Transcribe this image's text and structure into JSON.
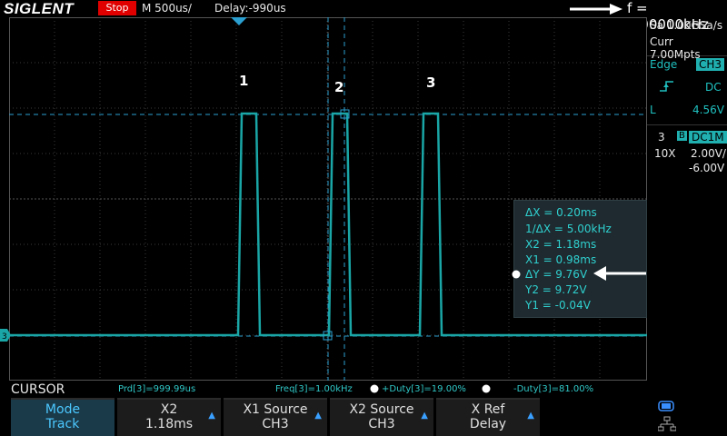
{
  "header": {
    "brand": "SIGLENT",
    "run_state": "Stop",
    "timebase": "M 500us/",
    "delay": "Delay:-990us",
    "frequency": "f = 1.00000kHz"
  },
  "acquisition": {
    "sample_rate": "Sa 1.00GSa/s",
    "memory": "Curr 7.00Mpts"
  },
  "trigger": {
    "type": "Edge",
    "source": "CH3",
    "coupling": "DC",
    "level_label": "L",
    "level": "4.56V"
  },
  "channel": {
    "number": "3",
    "bw_icon": "B",
    "coupling": "DC1M",
    "probe": "10X",
    "scale": "2.00V/",
    "offset": "-6.00V"
  },
  "markers": [
    "1",
    "2",
    "3"
  ],
  "cursor_readout": {
    "dx": "ΔX = 0.20ms",
    "inv_dx": "1/ΔX = 5.00kHz",
    "x2": "X2 = 1.18ms",
    "x1": "X1 = 0.98ms",
    "dy": "ΔY = 9.76V",
    "y2": "Y2 = 9.72V",
    "y1": "Y1 = -0.04V"
  },
  "measurements": {
    "title": "CURSOR",
    "prd": "Prd[3]=999.99us",
    "freq": "Freq[3]=1.00kHz",
    "pos_duty": "+Duty[3]=19.00%",
    "neg_duty": "-Duty[3]=81.00%"
  },
  "softkeys": [
    {
      "line1": "Mode",
      "line2": "Track"
    },
    {
      "line1": "X2",
      "line2": "1.18ms"
    },
    {
      "line1": "X1 Source",
      "line2": "CH3"
    },
    {
      "line1": "X2 Source",
      "line2": "CH3"
    },
    {
      "line1": "X Ref",
      "line2": "Delay"
    }
  ],
  "colors": {
    "trace": "#1aa6a6",
    "cursor": "#2a9fd0",
    "grid": "#404040",
    "stop": "#e00000"
  },
  "icons": {
    "usb": "usb-icon",
    "network": "network-icon"
  }
}
